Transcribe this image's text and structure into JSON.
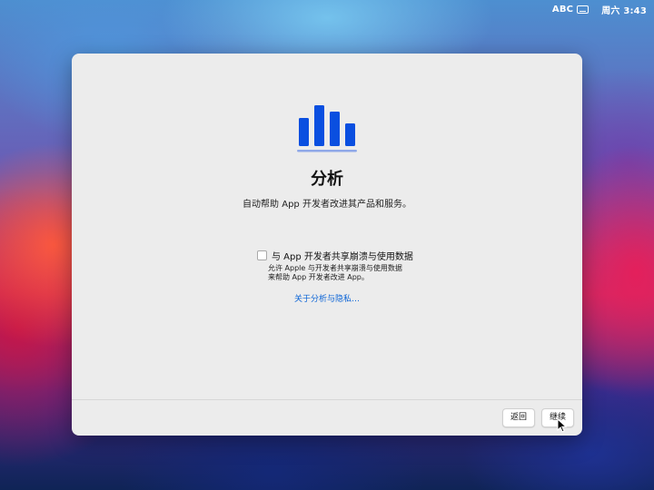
{
  "menubar": {
    "input_source": "ABC",
    "clock": "周六 3:43"
  },
  "window": {
    "title": "分析",
    "subtitle": "自动帮助 App 开发者改进其产品和服务。",
    "share_option": {
      "label": "与 App 开发者共享崩溃与使用数据",
      "checked": false,
      "description_line1": "允许 Apple 与开发者共享崩溃与使用数据",
      "description_line2": "来帮助 App 开发者改进 App。"
    },
    "privacy_link": "关于分析与隐私…",
    "buttons": {
      "back": "返回",
      "continue": "继续"
    }
  },
  "colors": {
    "accent": "#0a63d6",
    "icon_blue": "#0a4fe0",
    "icon_underline": "#8fa8e8"
  },
  "icons": {
    "hero": "analytics-bar-chart-icon",
    "keyboard": "keyboard-icon",
    "cursor": "mouse-pointer-icon"
  }
}
